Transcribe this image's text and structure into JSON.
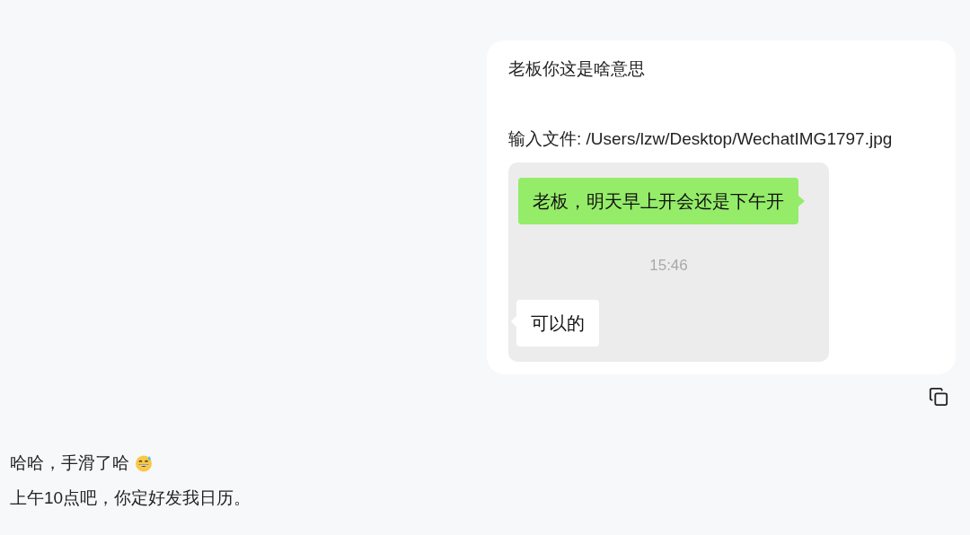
{
  "user_message": {
    "lines": [
      "老板你这是啥意思",
      "输入文件: /Users/lzw/Desktop/WechatIMG1797.jpg"
    ],
    "attachment": {
      "messages": [
        {
          "kind": "sent",
          "text": "老板，明天早上开会还是下午开"
        },
        {
          "kind": "time",
          "text": "15:46"
        },
        {
          "kind": "received",
          "text": "可以的"
        }
      ]
    }
  },
  "reply": {
    "lines": [
      {
        "text": "哈哈，手滑了哈",
        "emoji": true
      },
      {
        "text": "上午10点吧，你定好发我日历。",
        "emoji": false
      }
    ]
  }
}
